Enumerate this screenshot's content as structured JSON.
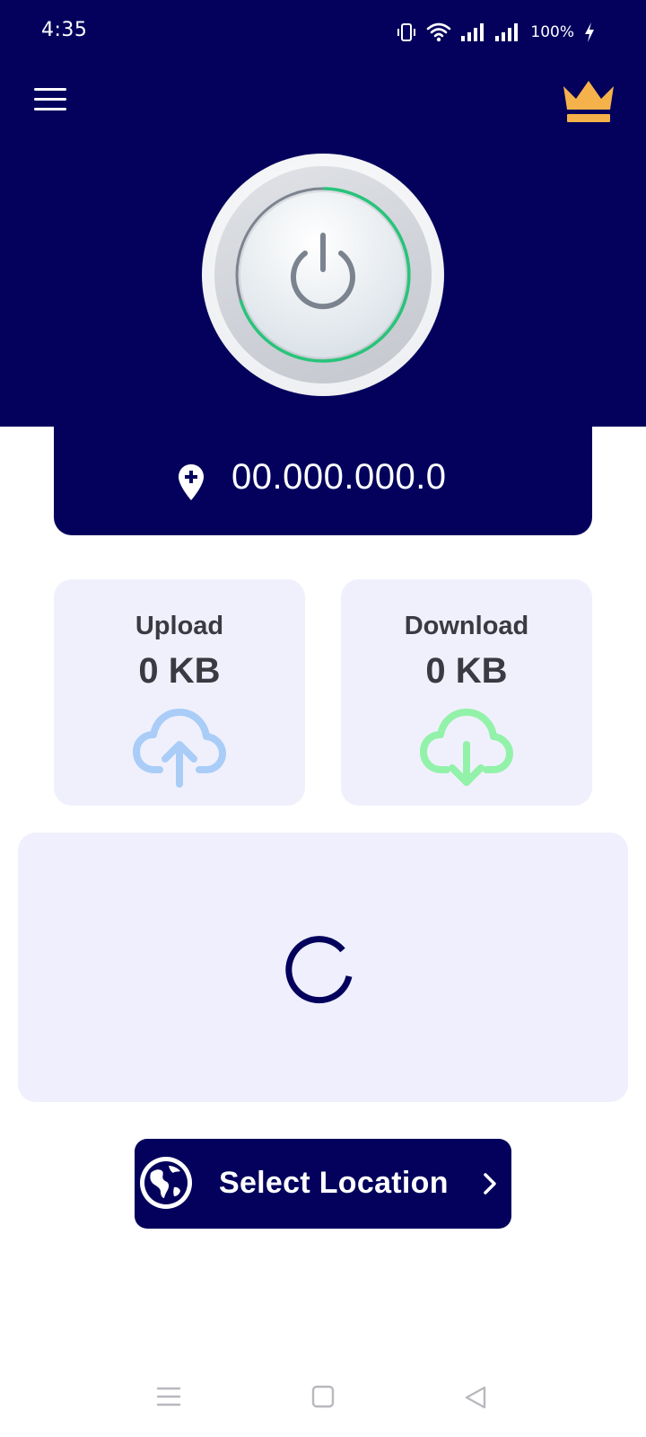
{
  "status_bar": {
    "time": "4:35",
    "battery": "100%",
    "icons": [
      "vibrate-icon",
      "wifi-icon",
      "signal-icon",
      "signal-icon",
      "charging-icon"
    ]
  },
  "header": {
    "menu_icon": "hamburger-menu-icon",
    "premium_icon": "crown-icon"
  },
  "connection": {
    "power_icon": "power-icon",
    "ip_address": "00.000.000.0",
    "ip_icon": "location-pin-plus-icon"
  },
  "stats": {
    "upload": {
      "label": "Upload",
      "value": "0 KB",
      "icon": "cloud-upload-icon"
    },
    "download": {
      "label": "Download",
      "value": "0 KB",
      "icon": "cloud-download-icon"
    }
  },
  "location_button": {
    "label": "Select Location",
    "icon": "globe-icon",
    "chevron": "chevron-right-icon"
  },
  "colors": {
    "primary": "#03015c",
    "card_bg": "#f0f0fd",
    "upload_accent": "#a9cdf7",
    "download_accent": "#93f2a9",
    "crown": "#f5b24a",
    "ring_green": "#28c47a"
  },
  "nav_bar": {
    "recents_icon": "recents-icon",
    "home_icon": "home-icon",
    "back_icon": "back-icon"
  }
}
